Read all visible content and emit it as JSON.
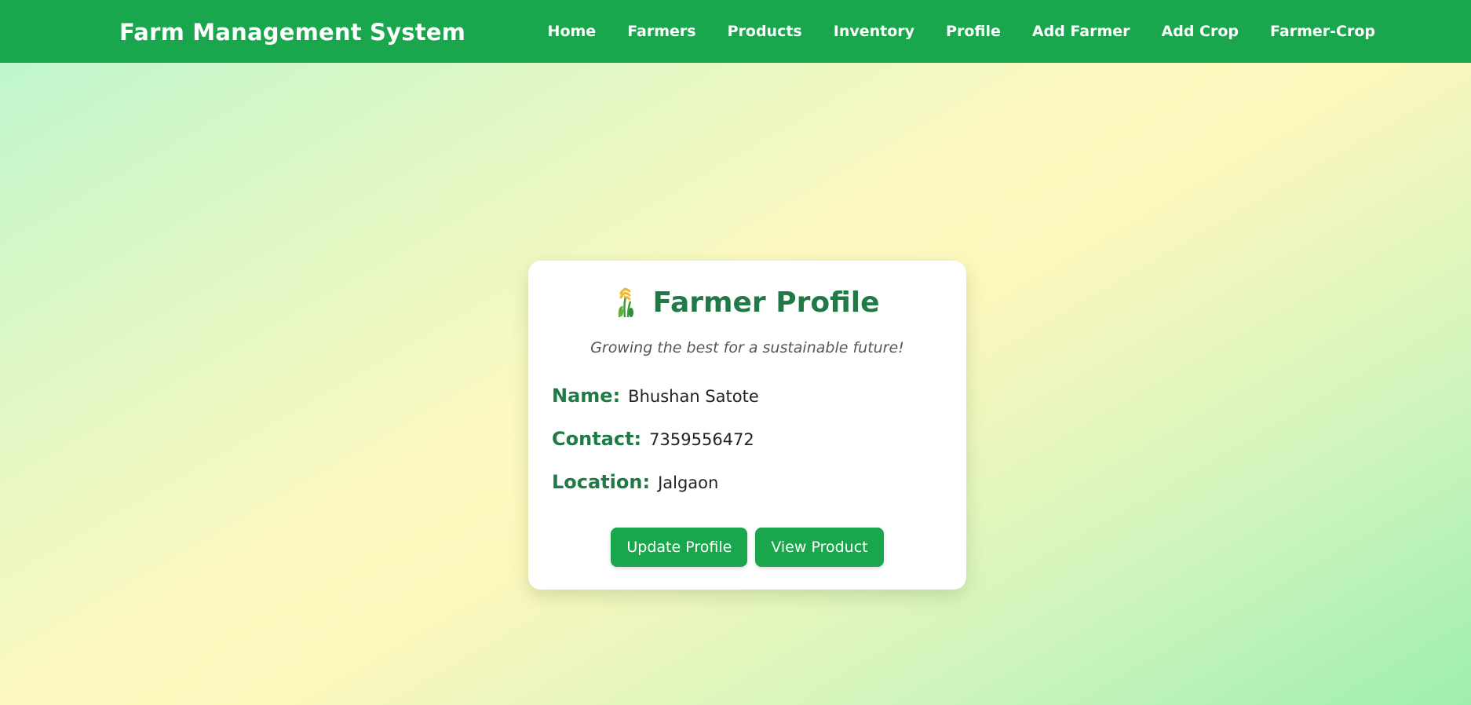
{
  "header": {
    "brand": "Farm Management System",
    "nav": [
      {
        "label": "Home"
      },
      {
        "label": "Farmers"
      },
      {
        "label": "Products"
      },
      {
        "label": "Inventory"
      },
      {
        "label": "Profile"
      },
      {
        "label": "Add Farmer"
      },
      {
        "label": "Add Crop"
      },
      {
        "label": "Farmer-Crop"
      }
    ]
  },
  "profile": {
    "icon": "wheat-icon",
    "title": "Farmer Profile",
    "tagline": "Growing the best for a sustainable future!",
    "fields": [
      {
        "label": "Name:",
        "value": "Bhushan Satote"
      },
      {
        "label": "Contact:",
        "value": "7359556472"
      },
      {
        "label": "Location:",
        "value": "Jalgaon"
      }
    ],
    "buttons": {
      "update": "Update Profile",
      "view": "View Product"
    }
  },
  "colors": {
    "primary": "#1aa64c",
    "heading": "#1f7a45"
  }
}
